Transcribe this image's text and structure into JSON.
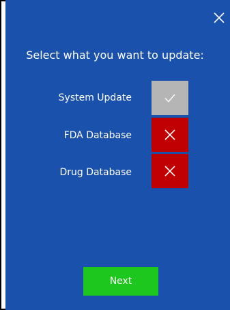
{
  "dialog": {
    "heading": "Select what you want to update:",
    "close_icon": "close-icon",
    "options": [
      {
        "label": "System Update",
        "selected": true,
        "icon": "check-icon"
      },
      {
        "label": "FDA Database",
        "selected": false,
        "icon": "x-icon"
      },
      {
        "label": "Drug Database",
        "selected": false,
        "icon": "x-icon"
      }
    ],
    "next_label": "Next"
  },
  "colors": {
    "background": "#1a51ad",
    "selected_toggle": "#b5b5b5",
    "unselected_toggle": "#c00000",
    "next_button": "#1ec71e",
    "text": "#ffffff"
  }
}
